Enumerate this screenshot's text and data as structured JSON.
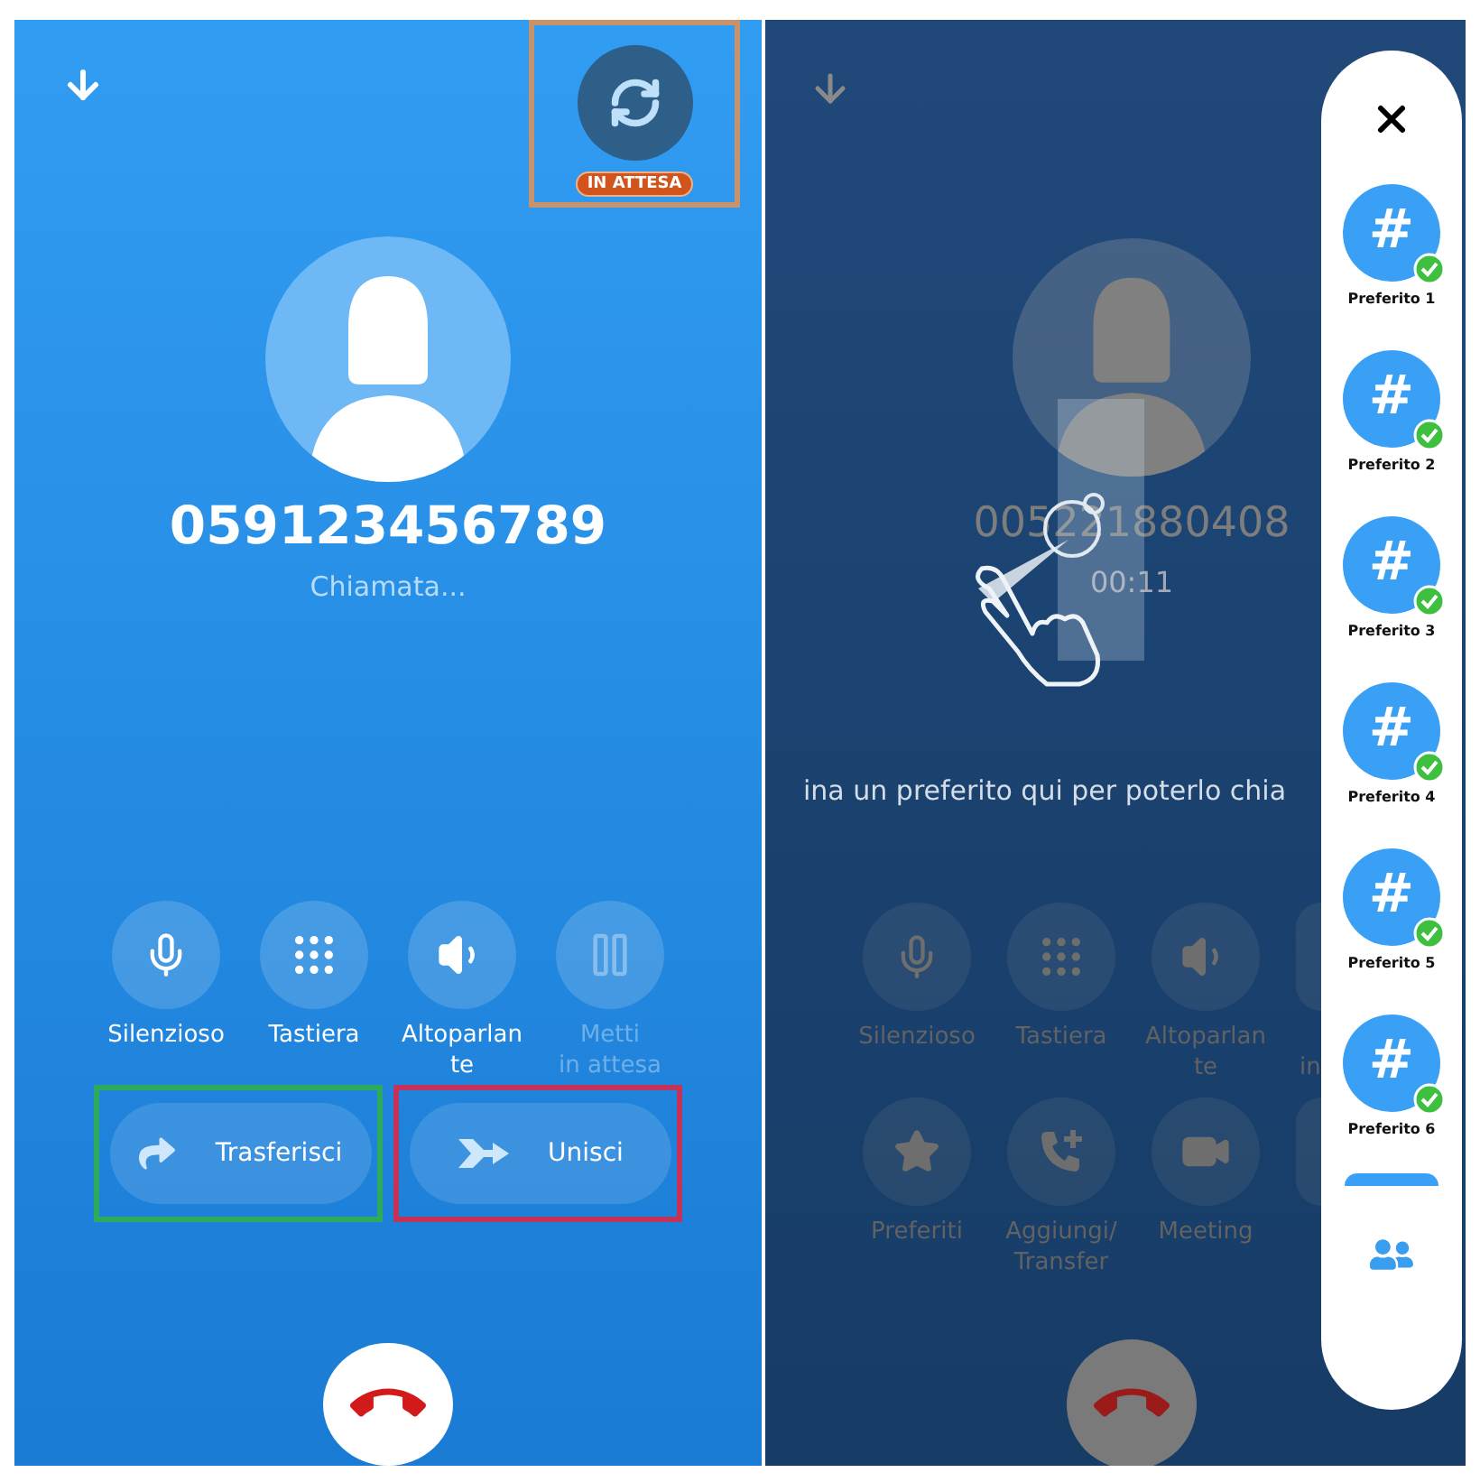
{
  "left_screen": {
    "hold_button": {
      "badge": "IN ATTESA",
      "color": "#c8926a"
    },
    "caller": {
      "number": "059123456789",
      "status": "Chiamata..."
    },
    "actions": [
      {
        "kind": "mic",
        "label": "Silenzioso",
        "disabled": false
      },
      {
        "kind": "keypad",
        "label": "Tastiera",
        "disabled": false
      },
      {
        "kind": "speaker",
        "label": "Altoparlan\nte",
        "disabled": false
      },
      {
        "kind": "pause",
        "label": "Metti\nin attesa",
        "disabled": true
      }
    ],
    "call_buttons": [
      {
        "kind": "transfer",
        "label": "Trasferisci",
        "color": "#2faa5a"
      },
      {
        "kind": "merge",
        "label": "Unisci",
        "color": "#c4325a"
      }
    ]
  },
  "right_screen": {
    "caller": {
      "number": "005221880408",
      "timer": "00:11"
    },
    "hint": "ina un preferito qui per poterlo chia",
    "actions": [
      {
        "kind": "mic",
        "label": "Silenzioso"
      },
      {
        "kind": "keypad",
        "label": "Tastiera"
      },
      {
        "kind": "speaker",
        "label": "Altoparlan\nte"
      },
      {
        "kind": "cut",
        "label": "in"
      },
      {
        "kind": "star",
        "label": "Preferiti"
      },
      {
        "kind": "add-call",
        "label": "Aggiungi/\nTransfer"
      },
      {
        "kind": "video",
        "label": "Meeting"
      },
      {
        "kind": "cut"
      }
    ],
    "favorites_panel": {
      "items": [
        {
          "symbol": "#",
          "label": "Preferito 1",
          "online": true
        },
        {
          "symbol": "#",
          "label": "Preferito 2",
          "online": true
        },
        {
          "symbol": "#",
          "label": "Preferito 3",
          "online": true
        },
        {
          "symbol": "#",
          "label": "Preferito 4",
          "online": true
        },
        {
          "symbol": "#",
          "label": "Preferito 5",
          "online": true
        },
        {
          "symbol": "#",
          "label": "Preferito 6",
          "online": true
        }
      ],
      "more_below": true
    }
  }
}
